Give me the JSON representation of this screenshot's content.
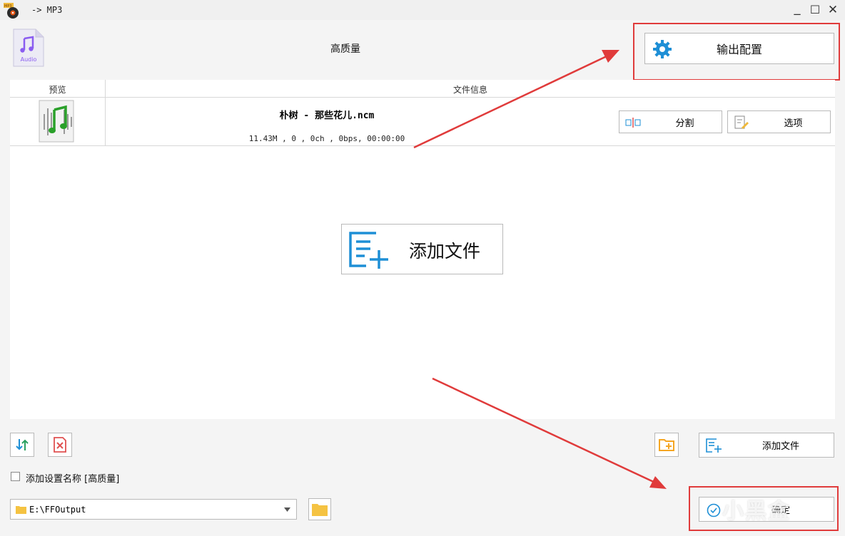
{
  "window": {
    "title": "-> MP3",
    "minimize": "_",
    "maximize": "☐",
    "close": "✕"
  },
  "header": {
    "audio_icon_text": "Audio",
    "preset_name": "高质量",
    "output_config_label": "输出配置"
  },
  "table": {
    "col_preview": "预览",
    "col_info": "文件信息",
    "rows": [
      {
        "name": "朴树 - 那些花儿.ncm",
        "meta": "11.43M , 0 , 0ch , 0bps, 00:00:00",
        "split_label": "分割",
        "options_label": "选项"
      }
    ]
  },
  "center": {
    "add_files_label": "添加文件"
  },
  "bottom": {
    "add_files_label": "添加文件",
    "checkbox_label": "添加设置名称 [高质量]",
    "checkbox_checked": false,
    "output_path": "E:\\FFOutput",
    "ok_label": "确定"
  },
  "watermark": "小黑盒",
  "colors": {
    "accent_blue": "#1e8fd6",
    "annotation_red": "#e03b3b",
    "folder_yellow": "#f5c342",
    "audio_purple": "#8a5cf0"
  }
}
